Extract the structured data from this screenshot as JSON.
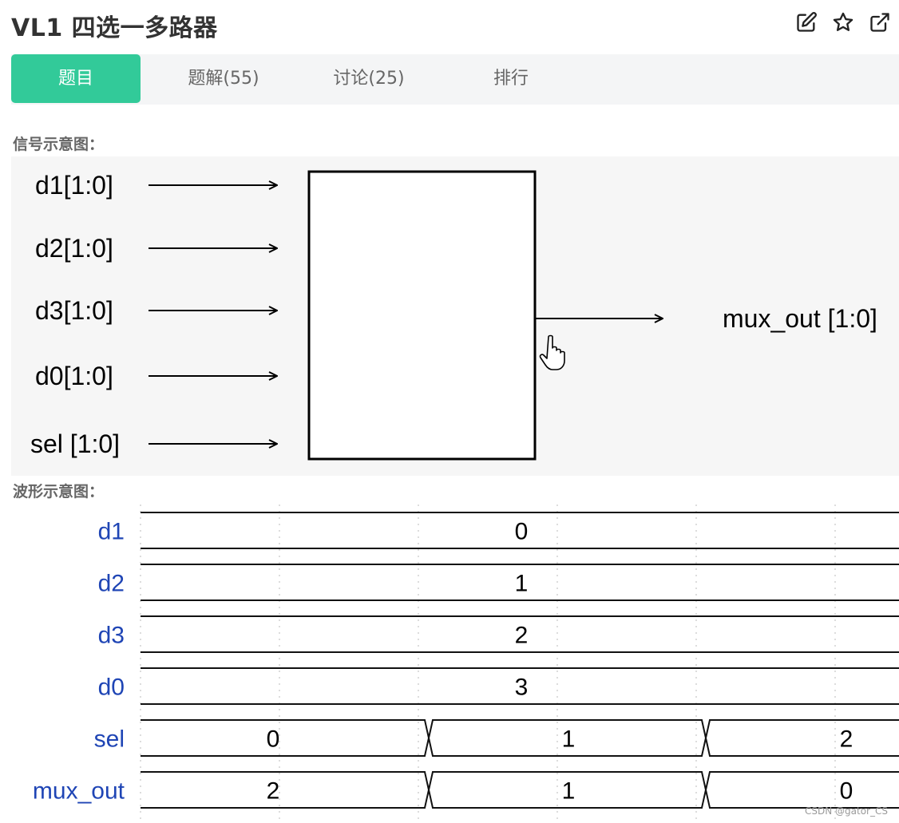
{
  "title": "VL1  四选一多路器",
  "title_icons": [
    "edit-icon",
    "star-icon",
    "external-link-icon"
  ],
  "tabs": [
    {
      "label": "题目",
      "active": true
    },
    {
      "label": "题解(55)",
      "active": false
    },
    {
      "label": "讨论(25)",
      "active": false
    },
    {
      "label": "排行",
      "active": false
    }
  ],
  "sections": {
    "signal_label": "信号示意图：",
    "wave_label": "波形示意图："
  },
  "signal_diagram": {
    "inputs": [
      "d1[1:0]",
      "d2[1:0]",
      "d3[1:0]",
      "d0[1:0]",
      "sel [1:0]"
    ],
    "output": "mux_out [1:0]"
  },
  "waveform": {
    "signals": [
      {
        "name": "d1",
        "values": [
          "0"
        ]
      },
      {
        "name": "d2",
        "values": [
          "1"
        ]
      },
      {
        "name": "d3",
        "values": [
          "2"
        ]
      },
      {
        "name": "d0",
        "values": [
          "3"
        ]
      },
      {
        "name": "sel",
        "values": [
          "0",
          "1",
          "2"
        ]
      },
      {
        "name": "mux_out",
        "values": [
          "2",
          "1",
          "0"
        ]
      }
    ]
  },
  "watermark": "CSDN @gator_CS",
  "colors": {
    "accent": "#32ca99",
    "signal_name": "#1f45b5",
    "wave_line": "#111111",
    "grid": "#bbbbbb"
  }
}
